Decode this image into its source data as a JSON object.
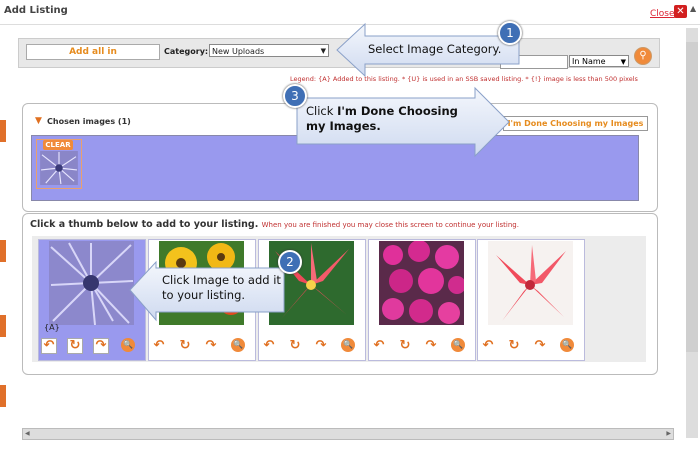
{
  "dialog": {
    "title": "Add Listing",
    "close_label": "Close",
    "close_icon": "x-icon"
  },
  "toolbar": {
    "add_all_label": "Add all in",
    "category_label": "Category:",
    "category_value": "New Uploads",
    "search_value": "",
    "sort_value": "In Name",
    "legend": "Legend: {A} Added to this listing. * {U} is used in an SSB saved listing. * {!} image is less than 500 pixels"
  },
  "chosen": {
    "title": "Chosen images (1)",
    "done_label": "I'm Done Choosing my Images",
    "clear_label": "CLEAR"
  },
  "thumbs": {
    "heading": "Click a thumb below to add to your listing.",
    "subheading": "When you are finished you may close this screen to continue your listing.",
    "items": [
      {
        "flag": "{A}",
        "selected": true
      },
      {
        "flag": "",
        "selected": false
      },
      {
        "flag": "",
        "selected": false
      },
      {
        "flag": "",
        "selected": false
      },
      {
        "flag": "",
        "selected": false
      }
    ]
  },
  "callouts": {
    "c1": {
      "num": "1",
      "text": "Select Image Category."
    },
    "c2": {
      "num": "2",
      "line1": "Click Image to add it",
      "line2": "to your listing."
    },
    "c3": {
      "num": "3",
      "line1_pre": "Click ",
      "line1_bold": "I'm Done Choosing",
      "line2": "my Images."
    }
  },
  "colors": {
    "accent_orange": "#e68c1f",
    "chosen_bg": "#9999ee",
    "callout_blue": "#3f6fb5",
    "legend_red": "#c03030"
  }
}
